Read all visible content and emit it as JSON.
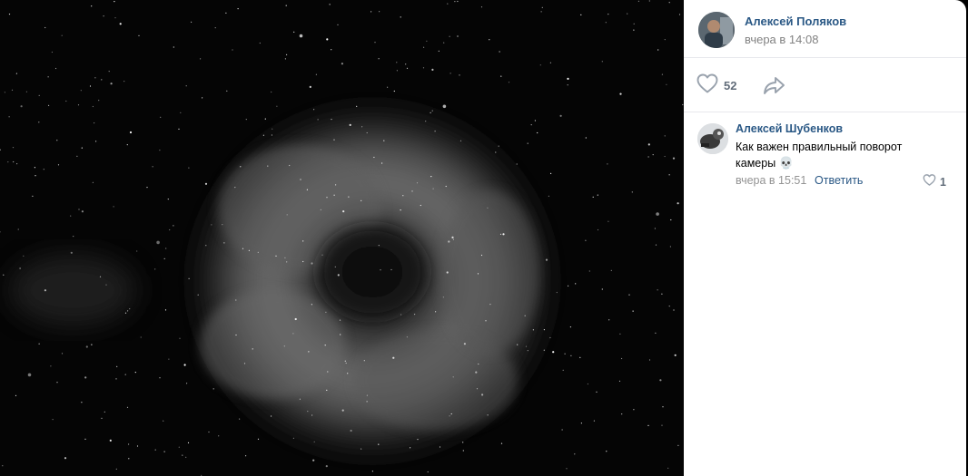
{
  "photo": {
    "description_icon": "nebula-photo"
  },
  "post": {
    "author_name": "Алексей Поляков",
    "timestamp": "вчера в 14:08",
    "likes_count": "52",
    "like_icon": "heart-outline-icon",
    "share_icon": "share-arrow-icon"
  },
  "comment": {
    "author_name": "Алексей Шубенков",
    "text": "Как важен правильный поворот камеры",
    "emoji": "💀",
    "timestamp": "вчера в 15:51",
    "reply_label": "Ответить",
    "likes_count": "1"
  },
  "colors": {
    "link": "#2a5885",
    "muted": "#828282",
    "icon": "#99a2ad",
    "divider": "#e7e8ec"
  }
}
